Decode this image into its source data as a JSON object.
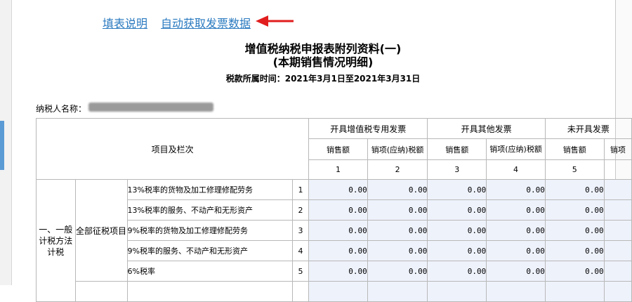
{
  "toolbar": {
    "instructions_link": "填表说明",
    "fetch_invoice_link": "自动获取发票数据"
  },
  "form": {
    "title_line1": "增值税纳税申报表附列资料(一)",
    "title_line2": "(本期销售情况明细)",
    "period_label": "税款所属时间：",
    "period_value": "2021年3月1日至2021年3月31日",
    "taxpayer_label": "纳税人名称："
  },
  "table": {
    "item_header": "项目及栏次",
    "groups": [
      "开具增值税专用发票",
      "开具其他发票",
      "未开具发票"
    ],
    "subheaders": [
      "销售额",
      "销项(应纳)税额",
      "销售额",
      "销项(应纳)税额",
      "销售额",
      "销项"
    ],
    "column_numbers": [
      "1",
      "2",
      "3",
      "4",
      "5"
    ],
    "category1": "一、一般计税方法计税",
    "category2": "全部征税项目",
    "rows": [
      {
        "desc": "13%税率的货物及加工修理修配劳务",
        "no": "1",
        "values": [
          "0.00",
          "0.00",
          "0.00",
          "0.00",
          "0.00"
        ]
      },
      {
        "desc": "13%税率的服务、不动产和无形资产",
        "no": "2",
        "values": [
          "0.00",
          "0.00",
          "0.00",
          "0.00",
          "0.00"
        ]
      },
      {
        "desc": "9%税率的货物及加工修理修配劳务",
        "no": "3",
        "values": [
          "0.00",
          "0.00",
          "0.00",
          "0.00",
          "0.00"
        ]
      },
      {
        "desc": "9%税率的服务、不动产和无形资产",
        "no": "4",
        "values": [
          "0.00",
          "0.00",
          "0.00",
          "0.00",
          "0.00"
        ]
      },
      {
        "desc": "6%税率",
        "no": "5",
        "values": [
          "0.00",
          "0.00",
          "0.00",
          "0.00",
          "0.00"
        ]
      }
    ]
  },
  "colors": {
    "link": "#2a7ac0",
    "arrow": "#e11d1d",
    "input_cell_bg": "#eef2fb",
    "grid_border": "#b8b8b8"
  },
  "icons": {
    "annotation_arrow": "red-arrow-icon"
  }
}
